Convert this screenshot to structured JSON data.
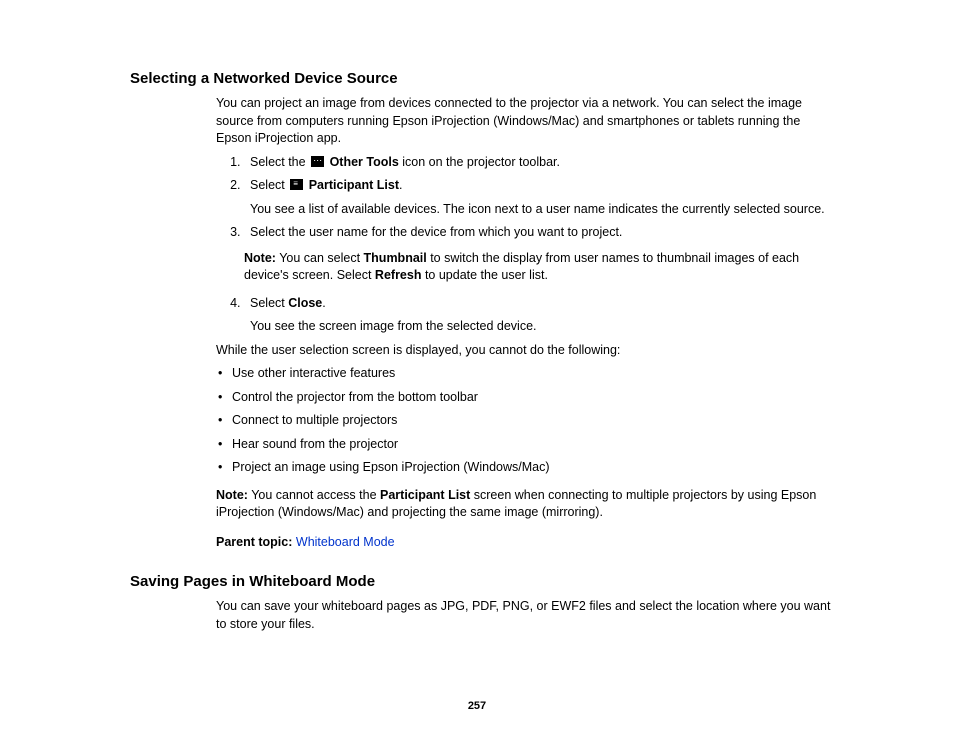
{
  "section1": {
    "heading": "Selecting a Networked Device Source",
    "intro": "You can project an image from devices connected to the projector via a network. You can select the image source from computers running Epson iProjection (Windows/Mac) and smartphones or tablets running the Epson iProjection app.",
    "step1_a": "Select the ",
    "step1_icon_label": "Other Tools",
    "step1_b": " icon on the projector toolbar.",
    "step2_a": "Select ",
    "step2_icon_label": "Participant List",
    "step2_b": ".",
    "step2_sub": "You see a list of available devices. The icon next to a user name indicates the currently selected source.",
    "step3": "Select the user name for the device from which you want to project.",
    "note1_label": "Note:",
    "note1_a": " You can select ",
    "note1_b1": "Thumbnail",
    "note1_c": " to switch the display from user names to thumbnail images of each device's screen. Select ",
    "note1_b2": "Refresh",
    "note1_d": " to update the user list.",
    "step4_a": "Select ",
    "step4_b": "Close",
    "step4_c": ".",
    "step4_sub": "You see the screen image from the selected device.",
    "while_text": "While the user selection screen is displayed, you cannot do the following:",
    "bullets": [
      "Use other interactive features",
      "Control the projector from the bottom toolbar",
      "Connect to multiple projectors",
      "Hear sound from the projector",
      "Project an image using Epson iProjection (Windows/Mac)"
    ],
    "note2_label": "Note:",
    "note2_a": " You cannot access the ",
    "note2_b": "Participant List",
    "note2_c": " screen when connecting to multiple projectors by using Epson iProjection (Windows/Mac) and projecting the same image (mirroring).",
    "parent_label": "Parent topic:",
    "parent_link": "Whiteboard Mode"
  },
  "section2": {
    "heading": "Saving Pages in Whiteboard Mode",
    "intro": "You can save your whiteboard pages as JPG, PDF, PNG, or EWF2 files and select the location where you want to store your files."
  },
  "page_number": "257"
}
